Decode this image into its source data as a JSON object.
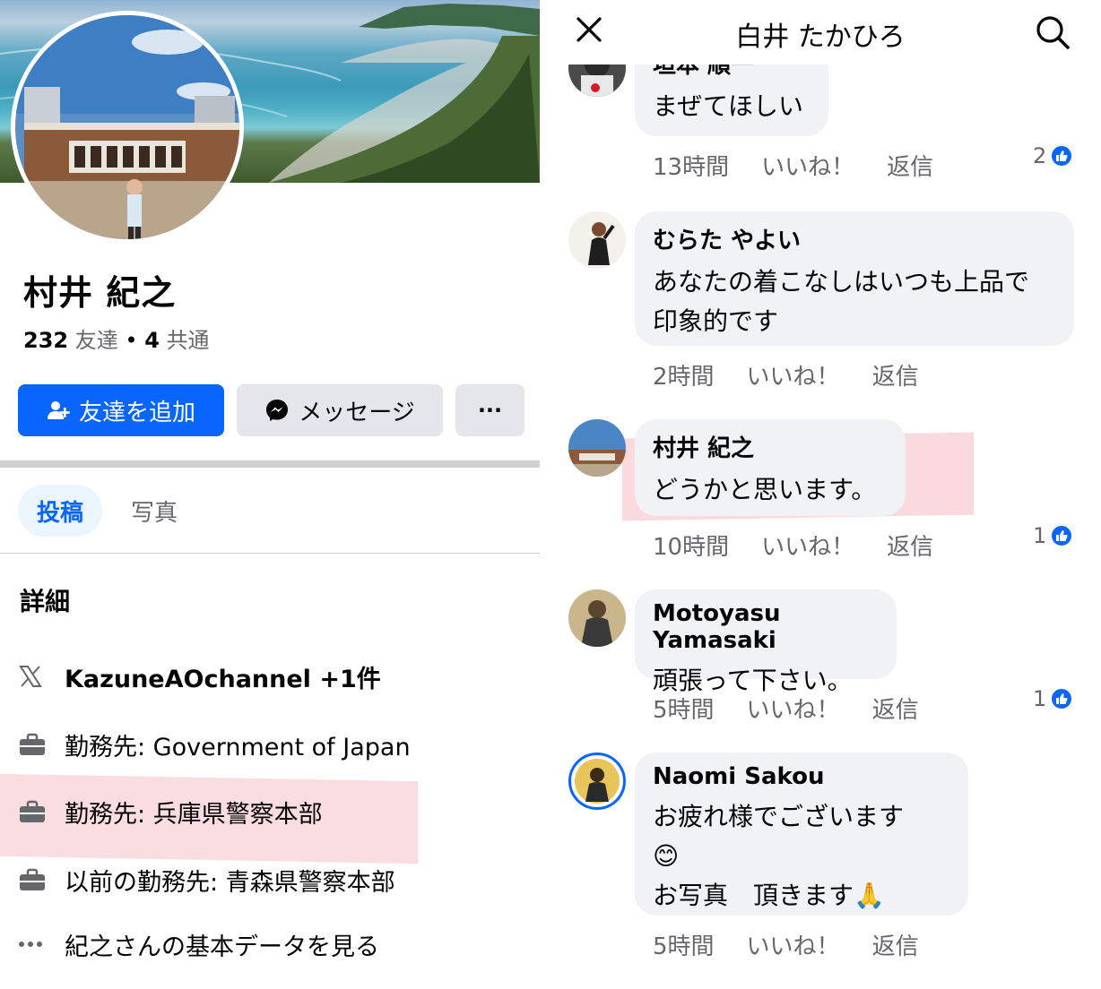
{
  "profile": {
    "name": "村井 紀之",
    "friends_count": "232",
    "friends_label": "友達",
    "mutual_count": "4",
    "mutual_label": "共通",
    "add_friend_label": "友達を追加",
    "message_label": "メッセージ",
    "more_label": "···"
  },
  "tabs": {
    "posts": "投稿",
    "photos": "写真"
  },
  "details": {
    "title": "詳細",
    "items": [
      {
        "icon": "x-logo-icon",
        "text": "KazuneAOchannel +1件"
      },
      {
        "icon": "briefcase-icon",
        "text": "勤務先: Government of Japan"
      },
      {
        "icon": "briefcase-icon",
        "text": "勤務先: 兵庫県警察本部"
      },
      {
        "icon": "briefcase-icon",
        "text": "以前の勤務先: 青森県警察本部"
      },
      {
        "icon": "more-dots-icon",
        "text": "紀之さんの基本データを見る"
      }
    ]
  },
  "comments_panel": {
    "title": "白井 たかひろ",
    "like_label": "いいね！",
    "reply_label": "返信",
    "comments": [
      {
        "name": "垣本 順一",
        "text": "まぜてほしい",
        "time": "13時間",
        "likes": "2"
      },
      {
        "name": "むらた やよい",
        "text_lines": [
          "あなたの着こなしはいつも上品で",
          "印象的です"
        ],
        "time": "2時間",
        "likes": ""
      },
      {
        "name": "村井 紀之",
        "text": "どうかと思います。",
        "time": "10時間",
        "likes": "1"
      },
      {
        "name": "Motoyasu Yamasaki",
        "text": "頑張って下さい。",
        "time": "5時間",
        "likes": "1"
      },
      {
        "name": "Naomi Sakou",
        "text_lines": [
          "お疲れ様でございます",
          "😊",
          "お写真　頂きます🙏"
        ],
        "time": "5時間",
        "likes": ""
      }
    ]
  },
  "colors": {
    "accent": "#0866ff",
    "secondary_bg": "#e4e6eb",
    "bubble_bg": "#f0f2f5",
    "muted_text": "#65676b"
  }
}
